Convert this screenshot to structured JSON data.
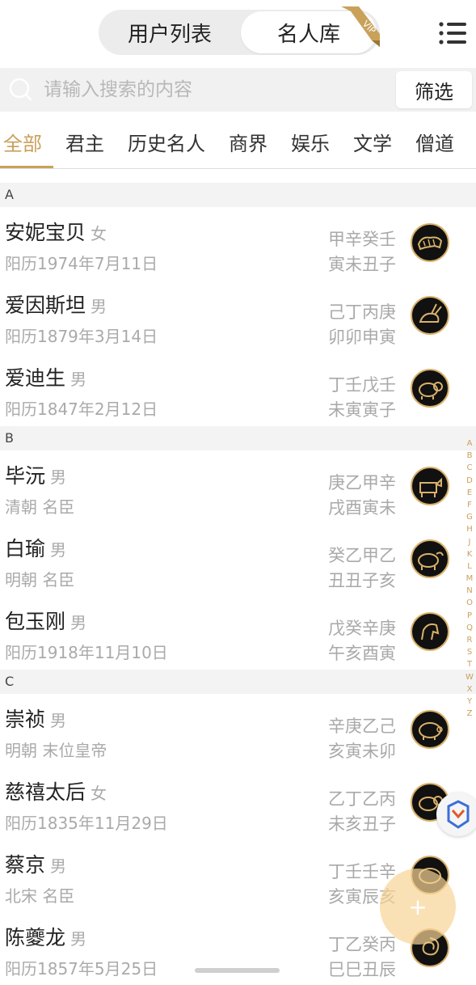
{
  "header": {
    "tab_user_list": "用户列表",
    "tab_celebrity": "名人库",
    "vip_badge": "VIP",
    "menu_icon": "hamburger-menu-icon",
    "accent_color": "#c9a15a"
  },
  "search": {
    "placeholder": "请输入搜索的内容",
    "filter_label": "筛选",
    "search_icon": "search-icon"
  },
  "tabs": [
    {
      "label": "全部",
      "active": true
    },
    {
      "label": "君主",
      "active": false
    },
    {
      "label": "历史名人",
      "active": false
    },
    {
      "label": "商界",
      "active": false
    },
    {
      "label": "娱乐",
      "active": false
    },
    {
      "label": "文学",
      "active": false
    },
    {
      "label": "僧道",
      "active": false
    }
  ],
  "sections": [
    {
      "letter": "A",
      "people": [
        {
          "name": "安妮宝贝",
          "gender": "女",
          "sub": "阳历1974年7月11日",
          "bazi_top": "甲辛癸壬",
          "bazi_bottom": "寅未丑子",
          "zodiac": "tiger-icon"
        },
        {
          "name": "爱因斯坦",
          "gender": "男",
          "sub": "阳历1879年3月14日",
          "bazi_top": "己丁丙庚",
          "bazi_bottom": "卯卯申寅",
          "zodiac": "rabbit-icon"
        },
        {
          "name": "爱迪生",
          "gender": "男",
          "sub": "阳历1847年2月12日",
          "bazi_top": "丁壬戊壬",
          "bazi_bottom": "未寅寅子",
          "zodiac": "goat-icon"
        }
      ]
    },
    {
      "letter": "B",
      "people": [
        {
          "name": "毕沅",
          "gender": "男",
          "sub": "清朝 名臣",
          "bazi_top": "庚乙甲辛",
          "bazi_bottom": "戌酉寅未",
          "zodiac": "dog-icon"
        },
        {
          "name": "白瑜",
          "gender": "男",
          "sub": "明朝 名臣",
          "bazi_top": "癸乙甲乙",
          "bazi_bottom": "丑丑子亥",
          "zodiac": "ox-icon"
        },
        {
          "name": "包玉刚",
          "gender": "男",
          "sub": "阳历1918年11月10日",
          "bazi_top": "戊癸辛庚",
          "bazi_bottom": "午亥酉寅",
          "zodiac": "horse-icon"
        }
      ]
    },
    {
      "letter": "C",
      "people": [
        {
          "name": "崇祯",
          "gender": "男",
          "sub": "明朝 末位皇帝",
          "bazi_top": "辛庚乙己",
          "bazi_bottom": "亥寅未卯",
          "zodiac": "pig-icon"
        },
        {
          "name": "慈禧太后",
          "gender": "女",
          "sub": "阳历1835年11月29日",
          "bazi_top": "乙丁乙丙",
          "bazi_bottom": "未亥丑子",
          "zodiac": "goat-icon"
        },
        {
          "name": "蔡京",
          "gender": "男",
          "sub": "北宋 名臣",
          "bazi_top": "丁壬壬辛",
          "bazi_bottom": "亥寅辰亥",
          "zodiac": "pig-icon"
        },
        {
          "name": "陈夔龙",
          "gender": "男",
          "sub": "阳历1857年5月25日",
          "bazi_top": "丁乙癸丙",
          "bazi_bottom": "巳巳丑辰",
          "zodiac": "snake-icon"
        }
      ]
    }
  ],
  "index_letters": [
    "A",
    "B",
    "C",
    "D",
    "E",
    "F",
    "G",
    "H",
    "J",
    "K",
    "L",
    "M",
    "N",
    "O",
    "P",
    "Q",
    "R",
    "S",
    "T",
    "W",
    "X",
    "Y",
    "Z"
  ],
  "fab_label": "+",
  "float_logo_icon": "app-logo-icon"
}
